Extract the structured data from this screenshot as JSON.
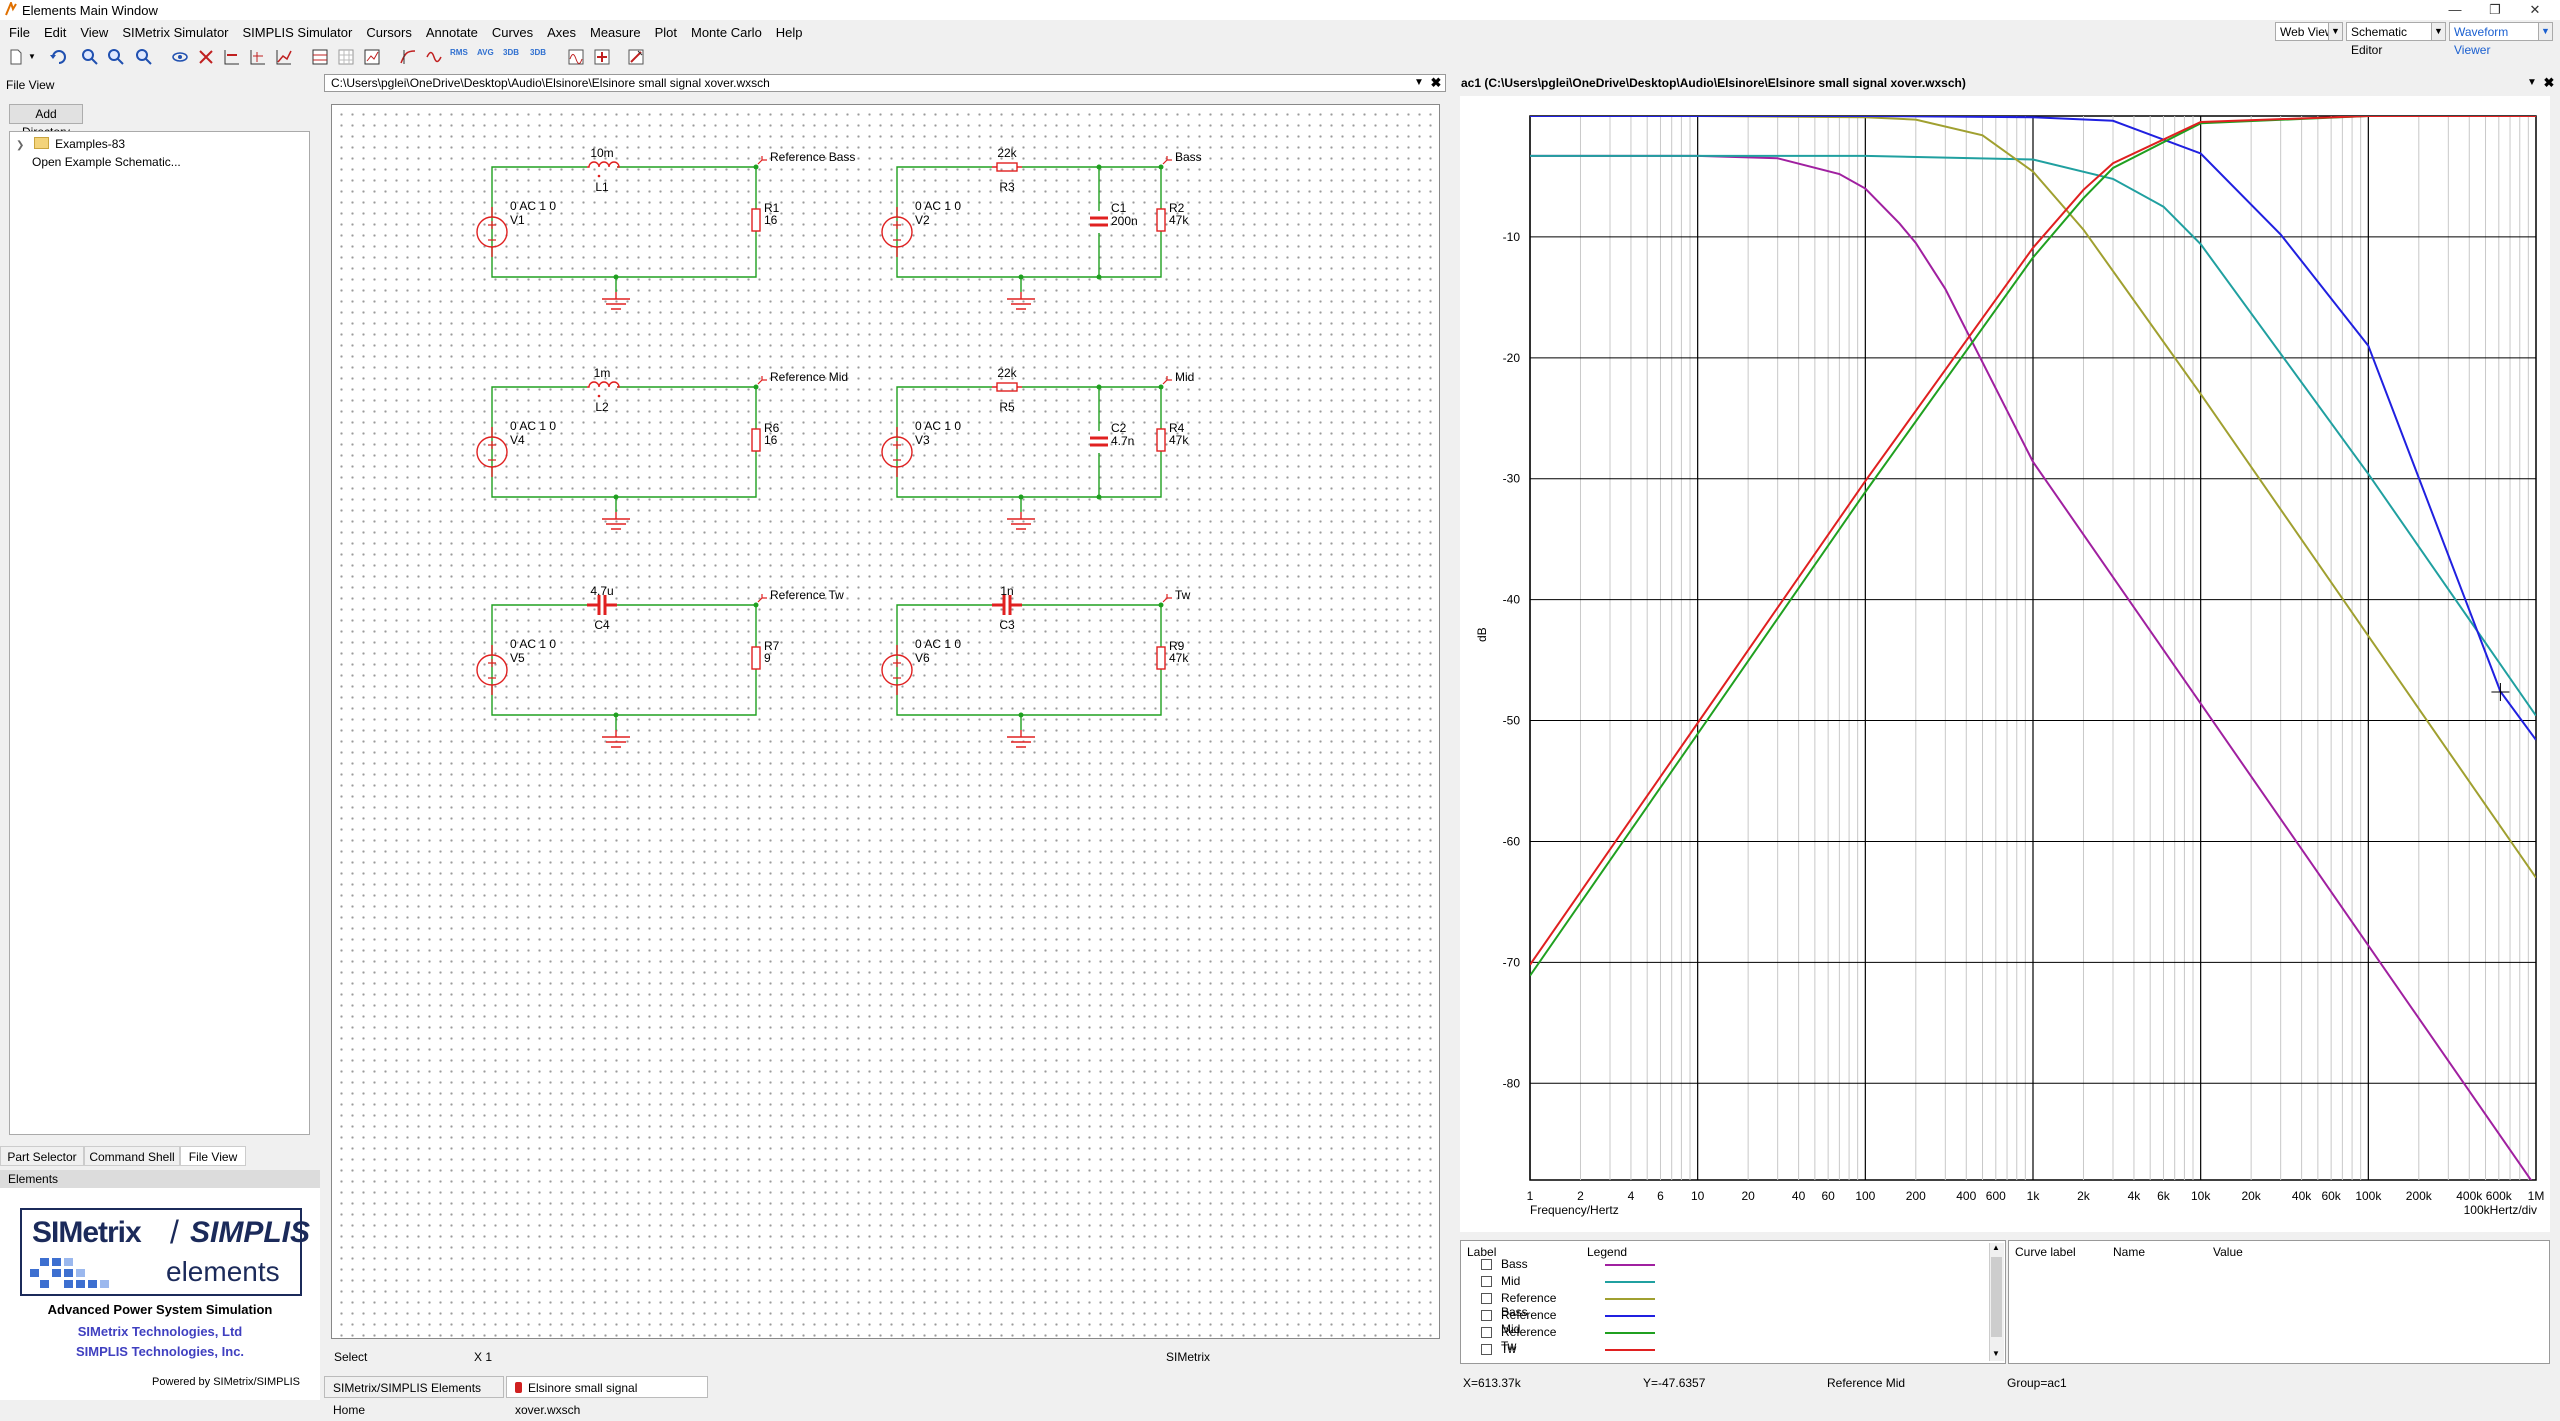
{
  "window": {
    "title": "Elements Main Window"
  },
  "menu": [
    "File",
    "Edit",
    "View",
    "SIMetrix Simulator",
    "SIMPLIS Simulator",
    "Cursors",
    "Annotate",
    "Curves",
    "Axes",
    "Measure",
    "Plot",
    "Monte Carlo",
    "Help"
  ],
  "views": {
    "web": "Web View",
    "schematic": "Schematic Editor",
    "waveform": "Waveform Viewer"
  },
  "toolbar_text": {
    "rms": "RMS",
    "avg": "AVG",
    "db3a": "3DB",
    "db3b": "3DB"
  },
  "left": {
    "fileview_title": "File View",
    "add_dir": "Add Directory",
    "tree": {
      "examples": "Examples-83",
      "open_example": "Open Example Schematic..."
    },
    "tabs": [
      "Part Selector",
      "Command Shell",
      "File View"
    ],
    "elements_header": "Elements",
    "logo": {
      "simetrix": "SIMetrix",
      "slash": "/",
      "simplis": "SIMPLIS",
      "elements": "elements"
    },
    "tagline": "Advanced Power System Simulation",
    "company1": "SIMetrix Technologies, Ltd",
    "company2": "SIMPLIS Technologies, Inc.",
    "powered": "Powered by SIMetrix/SIMPLIS"
  },
  "schematic": {
    "path": "C:\\Users\\pglei\\OneDrive\\Desktop\\Audio\\Elsinore\\Elsinore small signal xover.wxsch",
    "status": {
      "mode": "Select",
      "zoom": "X 1",
      "app": "SIMetrix"
    },
    "tabs": [
      "SIMetrix/SIMPLIS Elements Home",
      "Elsinore small signal xover.wxsch"
    ],
    "circuits": [
      {
        "source_val": "0 AC 1 0",
        "source_ref": "V1",
        "comp_val": "10m",
        "comp_ref": "L1",
        "res_ref": "R1",
        "res_val": "16",
        "probe": "Reference Bass"
      },
      {
        "source_val": "0 AC 1 0",
        "source_ref": "V2",
        "comp_val": "22k",
        "comp_ref": "R3",
        "cap_ref": "C1",
        "cap_val": "200n",
        "res_ref": "R2",
        "res_val": "47k",
        "probe": "Bass"
      },
      {
        "source_val": "0 AC 1 0",
        "source_ref": "V4",
        "comp_val": "1m",
        "comp_ref": "L2",
        "res_ref": "R6",
        "res_val": "16",
        "probe": "Reference Mid"
      },
      {
        "source_val": "0 AC 1 0",
        "source_ref": "V3",
        "comp_val": "22k",
        "comp_ref": "R5",
        "cap_ref": "C2",
        "cap_val": "4.7n",
        "res_ref": "R4",
        "res_val": "47k",
        "probe": "Mid"
      },
      {
        "source_val": "0 AC 1 0",
        "source_ref": "V5",
        "comp_val": "4.7u",
        "comp_ref": "C4",
        "res_ref": "R7",
        "res_val": "9",
        "probe": "Reference Tw"
      },
      {
        "source_val": "0 AC 1 0",
        "source_ref": "V6",
        "comp_val": "1n",
        "comp_ref": "C3",
        "res_ref": "R9",
        "res_val": "47k",
        "probe": "Tw"
      }
    ]
  },
  "waveform": {
    "title": "ac1 (C:\\Users\\pglei\\OneDrive\\Desktop\\Audio\\Elsinore\\Elsinore small signal xover.wxsch)",
    "legend_headers": {
      "label": "Label",
      "legend": "Legend"
    },
    "cursor_headers": {
      "curve_label": "Curve label",
      "name": "Name",
      "value": "Value"
    },
    "status": {
      "x": "X=613.37k",
      "y": "Y=-47.6357",
      "curve": "Reference Mid",
      "group": "Group=ac1"
    },
    "xunit_label": "Frequency/Hertz",
    "xdiv_label": "100kHertz/div",
    "ylabel": "dB"
  },
  "chart_data": {
    "type": "line",
    "xscale": "log",
    "xlim": [
      1,
      1000000
    ],
    "ylim": [
      -88,
      0
    ],
    "yticks": [
      -10,
      -20,
      -30,
      -40,
      -50,
      -60,
      -70,
      -80
    ],
    "xtick_labels": [
      {
        "v": 1,
        "t": "1"
      },
      {
        "v": 2,
        "t": "2"
      },
      {
        "v": 4,
        "t": "4"
      },
      {
        "v": 6,
        "t": "6"
      },
      {
        "v": 10,
        "t": "10"
      },
      {
        "v": 20,
        "t": "20"
      },
      {
        "v": 40,
        "t": "40"
      },
      {
        "v": 60,
        "t": "60"
      },
      {
        "v": 100,
        "t": "100"
      },
      {
        "v": 200,
        "t": "200"
      },
      {
        "v": 400,
        "t": "400"
      },
      {
        "v": 600,
        "t": "600"
      },
      {
        "v": 1000,
        "t": "1k"
      },
      {
        "v": 2000,
        "t": "2k"
      },
      {
        "v": 4000,
        "t": "4k"
      },
      {
        "v": 6000,
        "t": "6k"
      },
      {
        "v": 10000,
        "t": "10k"
      },
      {
        "v": 20000,
        "t": "20k"
      },
      {
        "v": 40000,
        "t": "40k"
      },
      {
        "v": 60000,
        "t": "60k"
      },
      {
        "v": 100000,
        "t": "100k"
      },
      {
        "v": 200000,
        "t": "200k"
      },
      {
        "v": 400000,
        "t": "400k"
      },
      {
        "v": 600000,
        "t": "600k"
      },
      {
        "v": 1000000,
        "t": "1M"
      }
    ],
    "grid": true,
    "legend": "bottom",
    "cursor": {
      "x": 613370,
      "y": -47.6357
    },
    "series": [
      {
        "name": "Bass",
        "color": "#a020a0",
        "x": [
          1,
          10,
          30,
          70,
          100,
          160,
          200,
          300,
          1000,
          10000,
          100000,
          1000000
        ],
        "y": [
          -3.3,
          -3.3,
          -3.5,
          -4.8,
          -6.0,
          -8.9,
          -10.5,
          -14.3,
          -28.6,
          -48.6,
          -68.6,
          -88.6
        ]
      },
      {
        "name": "Mid",
        "color": "#20a0a0",
        "x": [
          1,
          10,
          100,
          1000,
          3000,
          6000,
          10000,
          100000,
          1000000
        ],
        "y": [
          -3.3,
          -3.3,
          -3.3,
          -3.6,
          -5.2,
          -7.5,
          -10.6,
          -29.6,
          -49.6
        ]
      },
      {
        "name": "Reference Bass",
        "color": "#a0a030",
        "x": [
          1,
          10,
          100,
          200,
          500,
          1000,
          2000,
          10000,
          100000,
          1000000
        ],
        "y": [
          0,
          0,
          -0.1,
          -0.3,
          -1.6,
          -4.6,
          -9.4,
          -23.0,
          -43.0,
          -63.0
        ]
      },
      {
        "name": "Reference Mid",
        "color": "#2020e0",
        "x": [
          1,
          10,
          100,
          1000,
          3000,
          10000,
          30000,
          100000,
          613370,
          1000000
        ],
        "y": [
          0,
          0,
          0,
          -0.1,
          -0.4,
          -3.1,
          -9.8,
          -19.0,
          -47.6,
          -51.6
        ]
      },
      {
        "name": "Reference Tw",
        "color": "#20a020",
        "x": [
          1,
          10,
          100,
          1000,
          2000,
          3000,
          10000,
          100000,
          1000000
        ],
        "y": [
          -71.1,
          -51.1,
          -31.1,
          -11.7,
          -6.8,
          -4.3,
          -0.6,
          0,
          0
        ]
      },
      {
        "name": "Tw",
        "color": "#e02020",
        "x": [
          1,
          10,
          100,
          1000,
          2000,
          3000,
          10000,
          100000,
          1000000
        ],
        "y": [
          -70.2,
          -50.2,
          -30.2,
          -10.9,
          -6.1,
          -3.9,
          -0.5,
          0,
          0
        ]
      }
    ]
  }
}
